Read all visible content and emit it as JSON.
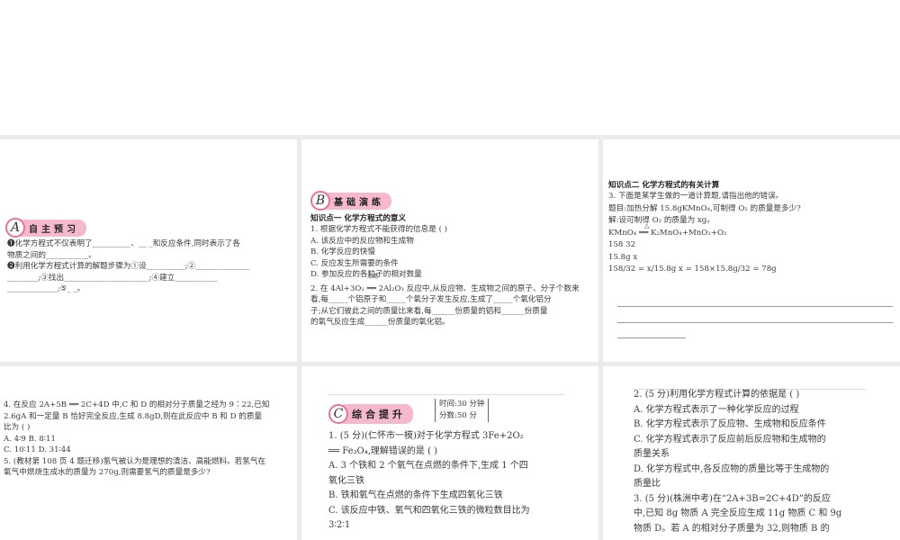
{
  "panel1": {
    "badge_letter": "A",
    "badge_label": "自主预习",
    "lines": [
      "❶化学方程式不仅表明了__________、__          _和反应条件,同时表示了各",
      "   物质之间的___________。",
      "❷利用化学方程式计算的解题步骤为①设__________;②______________",
      "   ________;③找出______________________;④建立___________",
      "   _____________;⑤_              _。"
    ]
  },
  "panel2": {
    "badge_letter": "B",
    "badge_label": "基础演练",
    "section": "知识点一   化学方程式的意义",
    "lines": [
      "1. 根据化学方程式不能获得的信息是                                    (      )",
      "   A. 该反应中的反应物和生成物",
      "   B. 化学反应的快慢",
      "   C. 反应发生所需要的条件",
      "   D. 参加反应的各粒子的相对数量",
      "2. 在 4Al+3O₂ ══ 2Al₂O₃ 反应中,从反应物、生成物之间的原子、分子个数来",
      "   看,每_____个铝原子和_____个氧分子发生反应,生成了_____个氧化铝分",
      "   子;从它们彼此之间的质量比来看,每______份质量的铝和______份质量",
      "   的氧气反应生成______份质量的氧化铝。"
    ],
    "cond": "点燃"
  },
  "panel3": {
    "section": "知识点二   化学方程式的有关计算",
    "lines": [
      "3. 下面是某学生做的一道计算题,请指出他的错误。",
      "   题目:加热分解 15.8gKMnO₄,可制得 O₂ 的质量是多少?",
      "   解:设可制得 O₂ 的质量为 xg。",
      "   KMnO₄  ══  K₂MnO₄+MnO₂+O₂",
      "   158                                       32",
      "   15.8g                                     x",
      "   158/32 = x/15.8g    x = 158×15.8g/32 = 78g"
    ],
    "cond": "△"
  },
  "panel4": {
    "lines": [
      "4. 在反应 2A+5B ══ 2C+4D 中,C 和 D 的相对分子质量之经为 9∶22,已知",
      "   2.6gA 和一定量 B 恰好完全反应,生成 8.8gD,则在此反应中 B 和 D 的质量",
      "   比为                                                              (      )",
      "   A. 4∶9                                      B. 8∶11",
      "   C. 10∶11                                    D. 31∶44",
      "5. (教材第 108 页 4 题迁移)氢气被认为是理想的清洁、高能燃料。若氢气在",
      "   氧气中燃烧生成水的质量为 270g,则需要氢气的质量是多少?"
    ]
  },
  "panel5": {
    "badge_letter": "C",
    "badge_label": "综合提升",
    "time": "时间:30 分钟",
    "score": "分数:50 分",
    "lines": [
      "1. (5 分)(仁怀市一模)对于化学方程式 3Fe+2O₂",
      "   ══ Fe₃O₄,理解错误的是                        (      )",
      "   A. 3 个铁和 2 个氧气在点燃的条件下,生成 1 个四",
      "      氧化三铁",
      "   B. 铁和氧气在点燃的条件下生成四氧化三铁",
      "   C. 该反应中铁、氧气和四氧化三铁的微粒数目比为",
      "      3∶2∶1"
    ]
  },
  "panel6": {
    "lines": [
      "2. (5 分)利用化学方程式计算的依据是          (      )",
      "   A. 化学方程式表示了一种化学反应的过程",
      "   B. 化学方程式表示了反应物、生成物和反应条件",
      "   C. 化学方程式表示了反应前后反应物和生成物的",
      "      质量关系",
      "   D. 化学方程式中,各反应物的质量比等于生成物的",
      "      质量比",
      "3. (5 分)(株洲中考)在“2A+3B=2C+4D”的反应",
      "   中,已知 8g 物质 A 完全反应生成 11g 物质 C 和 9g",
      "   物质 D。若 A 的相对分子质量为 32,则物质 B 的"
    ]
  }
}
